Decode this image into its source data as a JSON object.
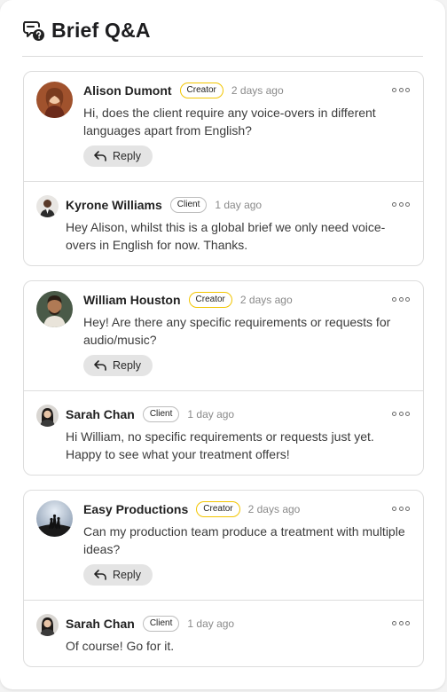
{
  "header": {
    "title": "Brief Q&A",
    "icon": "chat-question-icon"
  },
  "threads": [
    {
      "parent": {
        "name": "Alison Dumont",
        "role": "Creator",
        "time": "2 days ago",
        "text": "Hi, does the client require any voice-overs in different languages apart from English?",
        "reply_label": "Reply"
      },
      "reply": {
        "name": "Kyrone Williams",
        "role": "Client",
        "time": "1 day ago",
        "text": "Hey Alison, whilst this is a global brief we only need voice-overs in English for now. Thanks."
      }
    },
    {
      "parent": {
        "name": "William Houston",
        "role": "Creator",
        "time": "2 days ago",
        "text": "Hey! Are there any specific requirements or requests for audio/music?",
        "reply_label": "Reply"
      },
      "reply": {
        "name": "Sarah Chan",
        "role": "Client",
        "time": "1 day ago",
        "text": "Hi William, no specific requirements or requests just yet. Happy to see what your treatment offers!"
      }
    },
    {
      "parent": {
        "name": "Easy Productions",
        "role": "Creator",
        "time": "2 days ago",
        "text": "Can my production team produce a treatment with multiple ideas?",
        "reply_label": "Reply"
      },
      "reply": {
        "name": "Sarah Chan",
        "role": "Client",
        "time": "1 day ago",
        "text": "Of course! Go for it."
      }
    }
  ],
  "colors": {
    "creator_badge": "#f2c500",
    "client_badge": "#bdbdbd",
    "reply_button": "#e4e4e4"
  }
}
